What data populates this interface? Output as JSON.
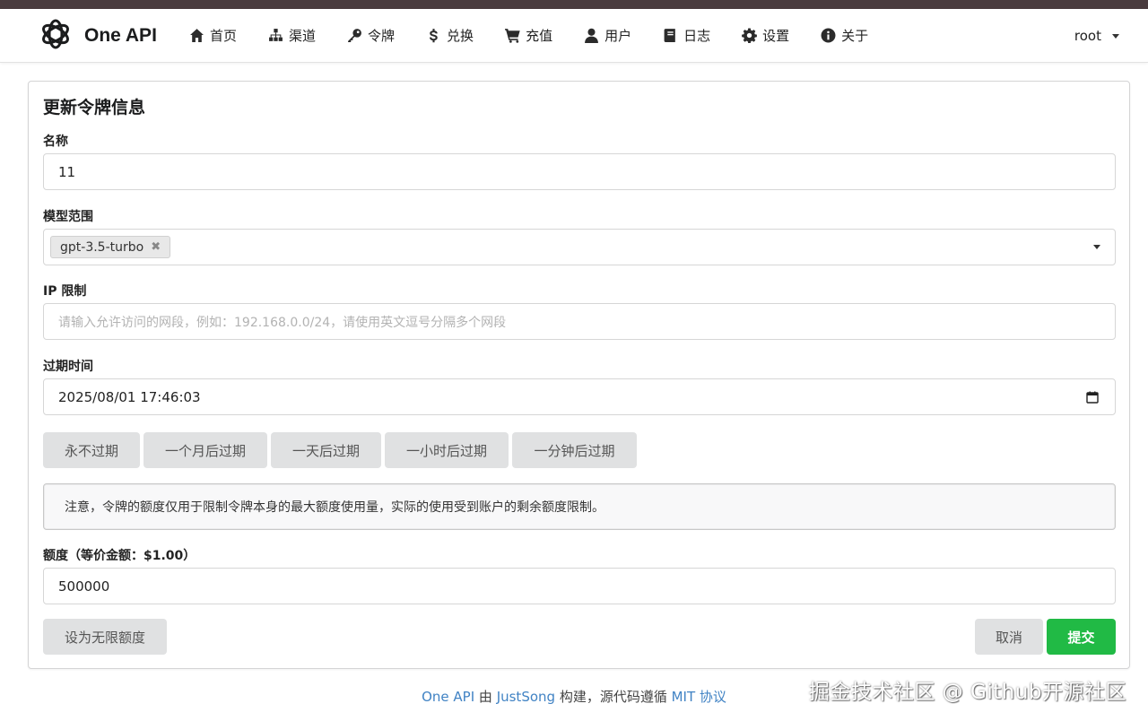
{
  "app": {
    "brand": "One API",
    "user": "root"
  },
  "nav": [
    {
      "label": "首页",
      "icon": "home-icon"
    },
    {
      "label": "渠道",
      "icon": "sitemap-icon"
    },
    {
      "label": "令牌",
      "icon": "key-icon"
    },
    {
      "label": "兑换",
      "icon": "dollar-icon"
    },
    {
      "label": "充值",
      "icon": "cart-icon"
    },
    {
      "label": "用户",
      "icon": "user-icon"
    },
    {
      "label": "日志",
      "icon": "book-icon"
    },
    {
      "label": "设置",
      "icon": "gear-icon"
    },
    {
      "label": "关于",
      "icon": "info-icon"
    }
  ],
  "form": {
    "title": "更新令牌信息",
    "name_label": "名称",
    "name_value": "11",
    "models_label": "模型范围",
    "models_selected": [
      "gpt-3.5-turbo"
    ],
    "ip_label": "IP 限制",
    "ip_placeholder": "请输入允许访问的网段，例如：192.168.0.0/24，请使用英文逗号分隔多个网段",
    "expiry_label": "过期时间",
    "expiry_value": "2025/08/01 17:46:03",
    "expiry_buttons": [
      "永不过期",
      "一个月后过期",
      "一天后过期",
      "一小时后过期",
      "一分钟后过期"
    ],
    "notice": "注意，令牌的额度仅用于限制令牌本身的最大额度使用量，实际的使用受到账户的剩余额度限制。",
    "quota_label": "额度（等价金额：$1.00）",
    "quota_value": "500000",
    "unlimited_button": "设为无限额度",
    "cancel_button": "取消",
    "submit_button": "提交"
  },
  "footer": {
    "brand_link": "One API",
    "by": " 由 ",
    "author_link": "JustSong",
    "mid": " 构建，源代码遵循 ",
    "license_link": "MIT 协议"
  },
  "watermark": "掘金技术社区 @ Github开源社区",
  "colors": {
    "primary": "#21ba45",
    "link": "#4183c4",
    "button": "#e0e1e2"
  }
}
